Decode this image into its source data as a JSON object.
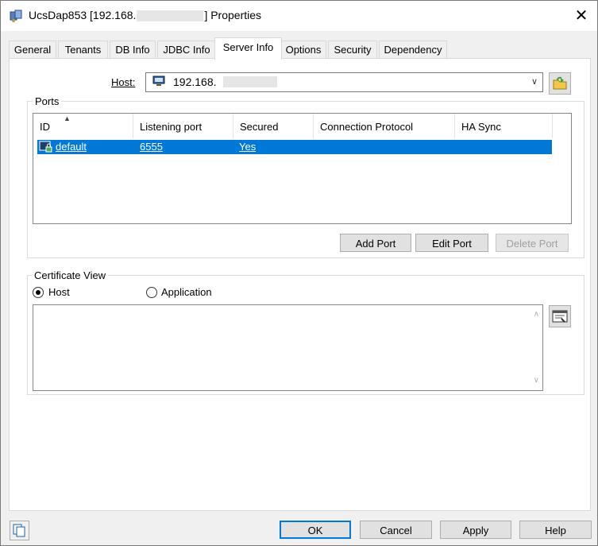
{
  "window": {
    "title_prefix": "UcsDap853 [192.168.",
    "title_suffix": "] Properties",
    "close_icon": "close-icon"
  },
  "tabs": [
    {
      "label": "General"
    },
    {
      "label": "Tenants"
    },
    {
      "label": "DB Info"
    },
    {
      "label": "JDBC Info"
    },
    {
      "label": "Server Info",
      "active": true
    },
    {
      "label": "Options"
    },
    {
      "label": "Security"
    },
    {
      "label": "Dependency"
    }
  ],
  "host": {
    "label": "Host:",
    "value": "192.168.",
    "icon": "monitor-icon",
    "action_icon": "folder-refresh-icon"
  },
  "ports": {
    "group_label": "Ports",
    "columns": [
      "ID",
      "Listening port",
      "Secured",
      "Connection Protocol",
      "HA Sync"
    ],
    "rows": [
      {
        "id": "default",
        "port": "6555",
        "secured": "Yes",
        "protocol": "",
        "ha_sync": ""
      }
    ],
    "buttons": {
      "add": "Add Port",
      "edit": "Edit Port",
      "delete": "Delete Port"
    }
  },
  "certificate": {
    "group_label": "Certificate View",
    "options": [
      {
        "label": "Host",
        "checked": true
      },
      {
        "label": "Application",
        "checked": false
      }
    ],
    "content": "",
    "view_icon": "certificate-view-icon"
  },
  "footer": {
    "ok": "OK",
    "cancel": "Cancel",
    "apply": "Apply",
    "help": "Help",
    "copy_icon": "copy-icon"
  },
  "colors": {
    "selection": "#0078d7",
    "default_button_border": "#0078d7",
    "window_bg": "#f0f0f0"
  }
}
